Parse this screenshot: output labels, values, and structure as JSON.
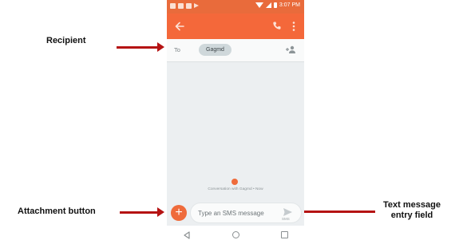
{
  "annotations": {
    "recipient": "Recipient",
    "attachment_button": "Attachment button",
    "text_message_field_line1": "Text message",
    "text_message_field_line2": "entry field"
  },
  "status_bar": {
    "time": "3:07 PM"
  },
  "recipient_row": {
    "to_label": "To",
    "chip": "Gagmd"
  },
  "conversation": {
    "meta": "Conversation with Gagmd • Now"
  },
  "composer": {
    "attach_glyph": "+",
    "placeholder": "Type an SMS message",
    "send_label": "SMS"
  },
  "colors": {
    "app_bar": "#f4683a",
    "status_bar": "#e96b3b",
    "accent": "#ef6b3b",
    "arrow": "#b51313"
  },
  "icons": [
    "back-arrow-icon",
    "phone-call-icon",
    "more-vert-icon",
    "add-person-icon",
    "plus-icon",
    "send-icon",
    "nav-back-icon",
    "nav-home-icon",
    "nav-recents-icon"
  ]
}
